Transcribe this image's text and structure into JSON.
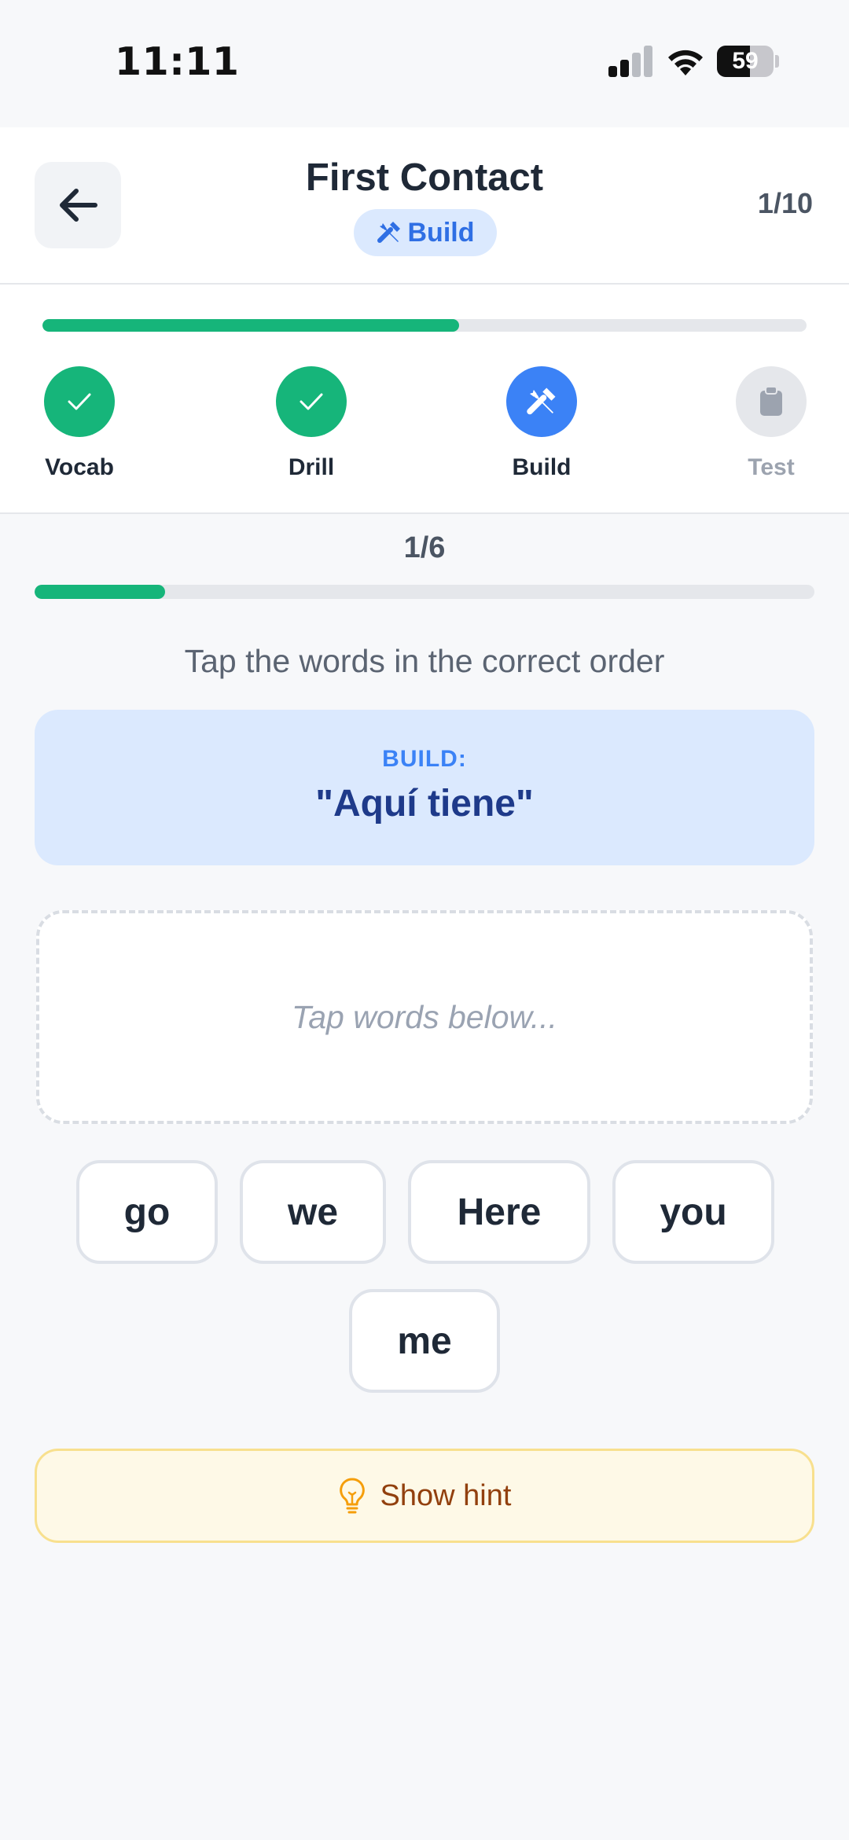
{
  "status_bar": {
    "time": "11:11",
    "battery_percent": "59",
    "battery_level": 0.59
  },
  "header": {
    "title": "First Contact",
    "mode_badge": "Build",
    "counter": "1/10"
  },
  "stage_progress": {
    "fraction": 0.545,
    "stages": [
      {
        "label": "Vocab",
        "state": "done",
        "icon": "check-icon"
      },
      {
        "label": "Drill",
        "state": "done",
        "icon": "check-icon"
      },
      {
        "label": "Build",
        "state": "active",
        "icon": "tools-icon"
      },
      {
        "label": "Test",
        "state": "locked",
        "icon": "clipboard-icon"
      }
    ]
  },
  "exercise": {
    "counter": "1/6",
    "fraction": 0.167,
    "instruction": "Tap the words in the correct order",
    "prompt_kicker": "BUILD:",
    "prompt_text": "\"Aquí tiene\"",
    "answer_placeholder": "Tap words below...",
    "word_bank": [
      "go",
      "we",
      "Here",
      "you",
      "me"
    ],
    "hint_label": "Show hint"
  },
  "colors": {
    "accent_green": "#16b57a",
    "accent_blue": "#3b82f6",
    "hint_background": "#fef9e7",
    "hint_text": "#92400e"
  }
}
